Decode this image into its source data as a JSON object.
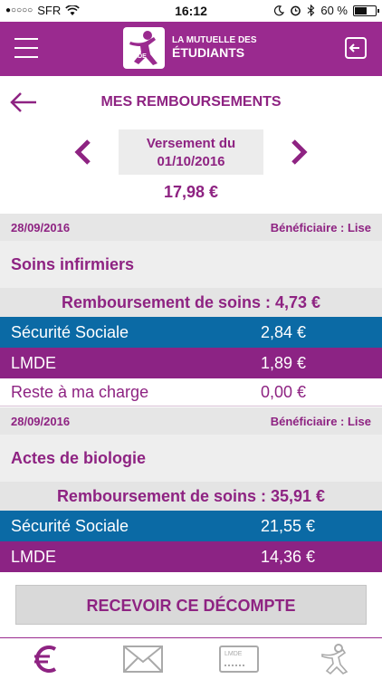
{
  "status_bar": {
    "signal": "●○○○○",
    "carrier": "SFR",
    "time": "16:12",
    "battery_text": "60 %",
    "battery_level": 0.6
  },
  "header": {
    "logo_line1": "LA MUTUELLE DES",
    "logo_line2": "ÉTUDIANTS",
    "logo_badge": "LMDE",
    "brand_color": "#9a2a8f"
  },
  "page": {
    "title": "MES REMBOURSEMENTS"
  },
  "payment": {
    "label": "Versement du",
    "date": "01/10/2016",
    "amount": "17,98 €"
  },
  "claims": [
    {
      "date": "28/09/2016",
      "beneficiary": "Bénéficiaire : Lise",
      "title": "Soins infirmiers",
      "total": "Remboursement de soins : 4,73 €",
      "lines": [
        {
          "label": "Sécurité Sociale",
          "value": "2,84 €",
          "kind": "secu"
        },
        {
          "label": "LMDE",
          "value": "1,89 €",
          "kind": "mutuelle"
        },
        {
          "label": "Reste à ma charge",
          "value": "0,00 €",
          "kind": "charge"
        }
      ]
    },
    {
      "date": "28/09/2016",
      "beneficiary": "Bénéficiaire : Lise",
      "title": "Actes de biologie",
      "total": "Remboursement de soins : 35,91 €",
      "lines": [
        {
          "label": "Sécurité Sociale",
          "value": "21,55 €",
          "kind": "secu"
        },
        {
          "label": "LMDE",
          "value": "14,36 €",
          "kind": "mutuelle"
        }
      ]
    }
  ],
  "actions": {
    "receive_label": "RECEVOIR CE DÉCOMPTE"
  },
  "tab_bar": {
    "card_label": "LMDE",
    "tabs": [
      {
        "icon": "euro-icon"
      },
      {
        "icon": "mail-icon"
      },
      {
        "icon": "card-icon"
      },
      {
        "icon": "profile-icon"
      }
    ]
  }
}
